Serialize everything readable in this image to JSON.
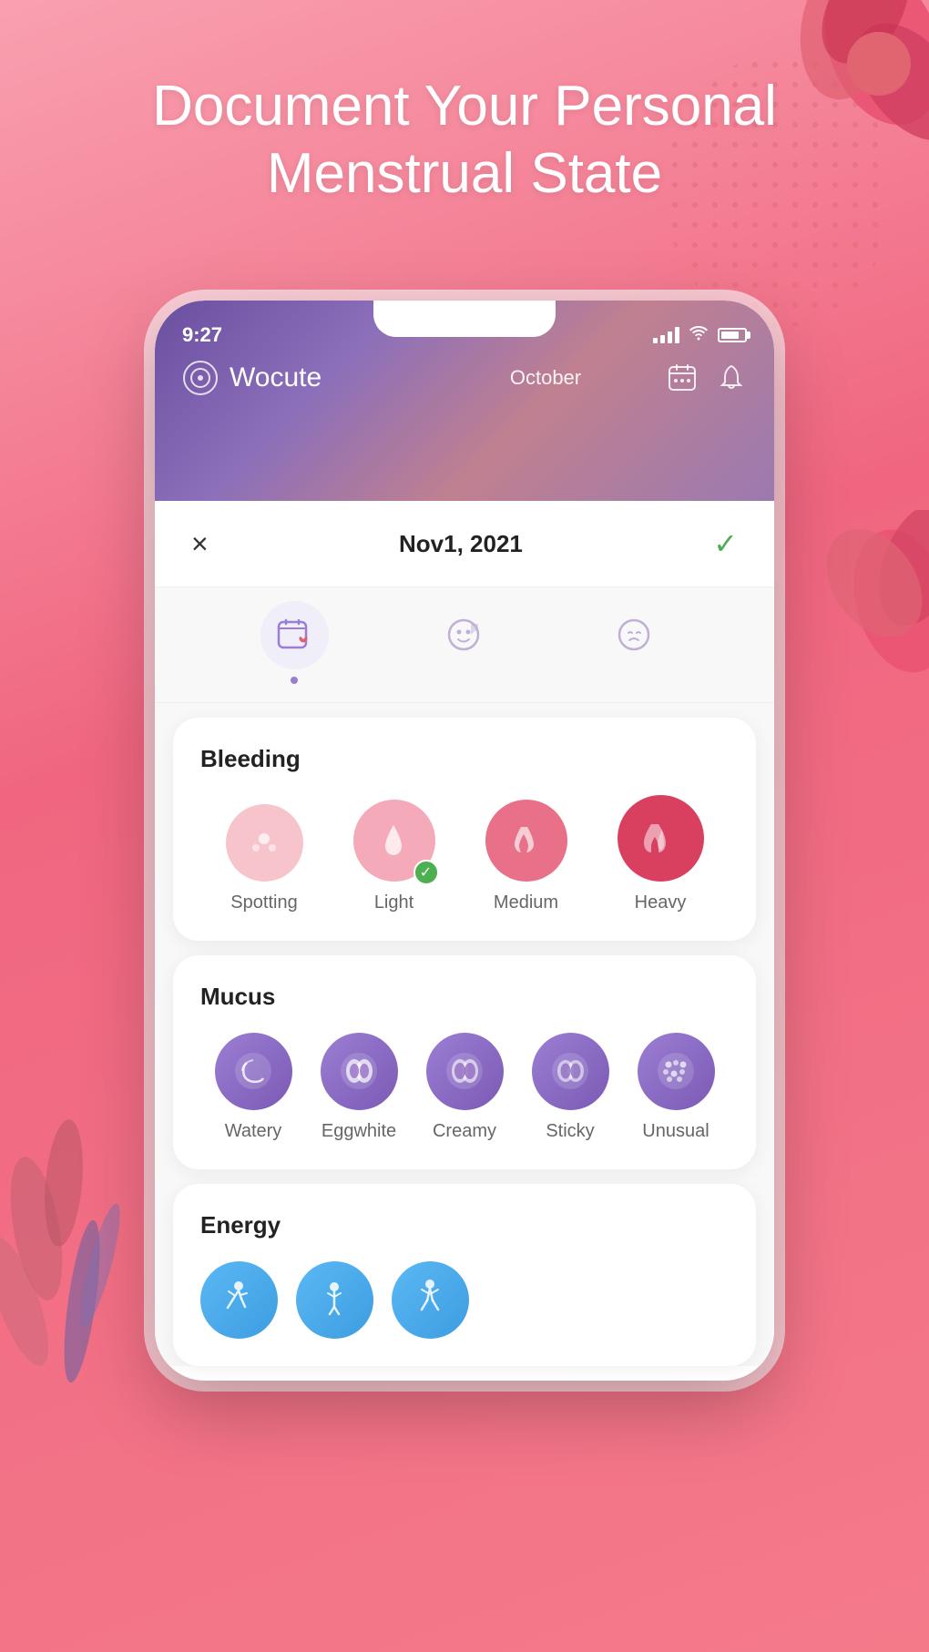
{
  "background": {
    "color": "#f6778a"
  },
  "title": {
    "line1": "Document Your Personal",
    "line2": "Menstrual State"
  },
  "phone": {
    "status_bar": {
      "time": "9:27"
    },
    "app_header": {
      "app_name": "Wocute",
      "month": "October"
    },
    "modal": {
      "date": "Nov1, 2021",
      "close_label": "×",
      "confirm_label": "✓"
    },
    "tabs": [
      {
        "id": "bleeding-tab",
        "active": true
      },
      {
        "id": "mood-tab",
        "active": false
      },
      {
        "id": "emotion-tab",
        "active": false
      }
    ],
    "bleeding_section": {
      "title": "Bleeding",
      "options": [
        {
          "id": "spotting",
          "label": "Spotting",
          "selected": false
        },
        {
          "id": "light",
          "label": "Light",
          "selected": true
        },
        {
          "id": "medium",
          "label": "Medium",
          "selected": false
        },
        {
          "id": "heavy",
          "label": "Heavy",
          "selected": false
        }
      ]
    },
    "mucus_section": {
      "title": "Mucus",
      "options": [
        {
          "id": "watery",
          "label": "Watery"
        },
        {
          "id": "eggwhite",
          "label": "Eggwhite"
        },
        {
          "id": "creamy",
          "label": "Creamy"
        },
        {
          "id": "sticky",
          "label": "Sticky"
        },
        {
          "id": "unusual",
          "label": "Unusual"
        }
      ]
    },
    "energy_section": {
      "title": "Energy",
      "options": [
        {
          "id": "energy1",
          "label": ""
        },
        {
          "id": "energy2",
          "label": ""
        },
        {
          "id": "energy3",
          "label": ""
        }
      ]
    }
  }
}
